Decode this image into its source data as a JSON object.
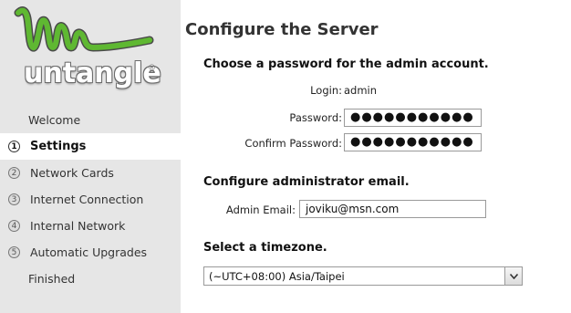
{
  "brand": {
    "name": "untangle",
    "registered": "®"
  },
  "sidebar": {
    "items": [
      {
        "num": "",
        "label": "Welcome",
        "active": false
      },
      {
        "num": "1",
        "label": "Settings",
        "active": true
      },
      {
        "num": "2",
        "label": "Network Cards",
        "active": false
      },
      {
        "num": "3",
        "label": "Internet Connection",
        "active": false
      },
      {
        "num": "4",
        "label": "Internal Network",
        "active": false
      },
      {
        "num": "5",
        "label": "Automatic Upgrades",
        "active": false
      },
      {
        "num": "",
        "label": "Finished",
        "active": false
      }
    ]
  },
  "main": {
    "title": "Configure the Server",
    "password_section": {
      "title": "Choose a password for the admin account.",
      "login_label": "Login:",
      "login_value": "admin",
      "password_label": "Password:",
      "password_value": "●●●●●●●●●●●",
      "confirm_label": "Confirm Password:",
      "confirm_value": "●●●●●●●●●●●"
    },
    "email_section": {
      "title": "Configure administrator email.",
      "email_label": "Admin Email:",
      "email_value": "joviku@msn.com"
    },
    "timezone_section": {
      "title": "Select a timezone.",
      "selected": "(~UTC+08:00) Asia/Taipei"
    }
  },
  "colors": {
    "logo_green": "#5fb832",
    "logo_outline": "#6b6b6b",
    "sidebar_bg": "#e6e6e6"
  }
}
